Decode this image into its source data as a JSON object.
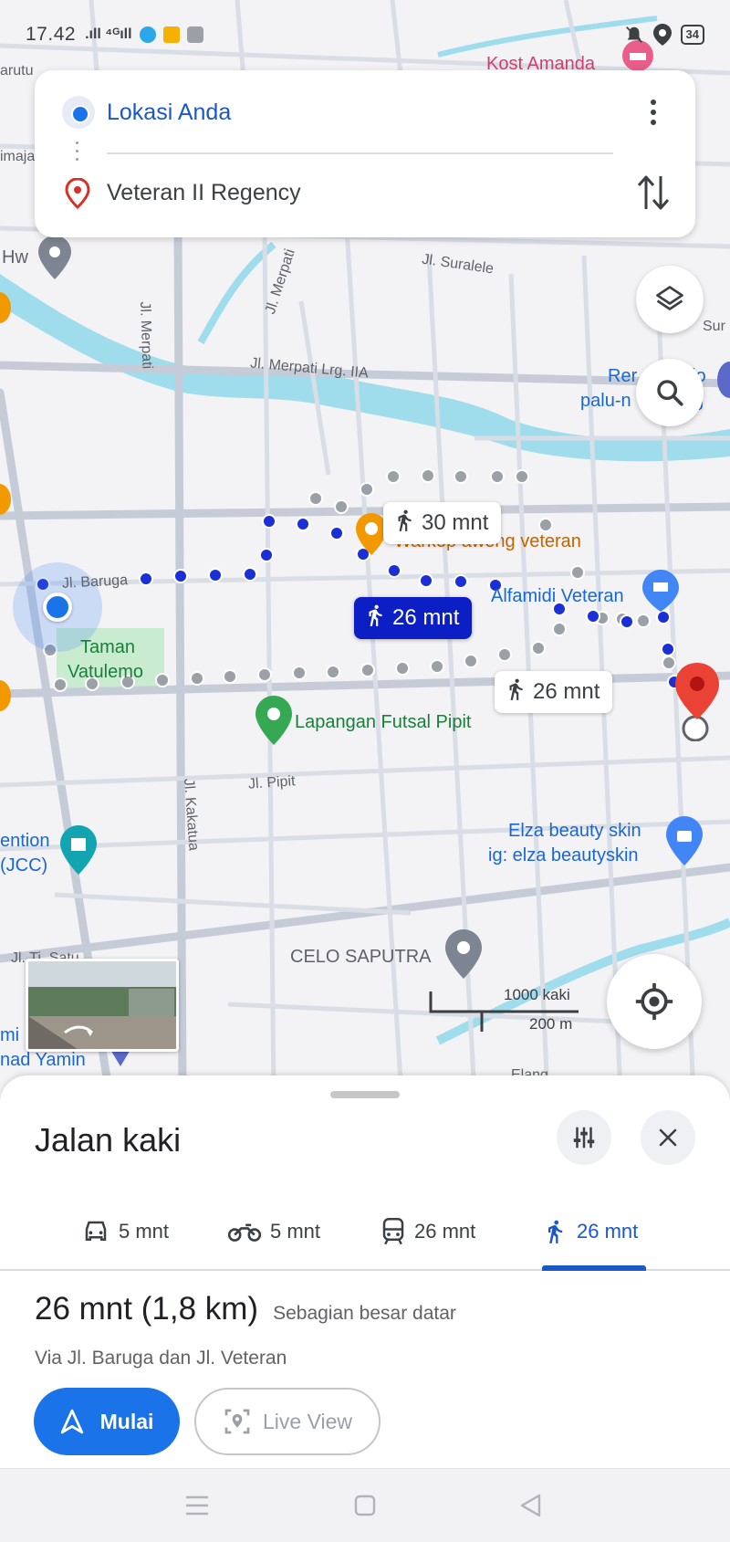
{
  "status_bar": {
    "time": "17.42",
    "signal": ".ıll ⁴ᴳıll",
    "battery": "34",
    "icons": [
      "telegram-icon",
      "gallery-icon",
      "storage-icon",
      "mute-icon",
      "location-icon",
      "battery-icon"
    ]
  },
  "search": {
    "origin": "Lokasi Anda",
    "destination": "Veteran II Regency"
  },
  "map": {
    "labels": {
      "kost": "Kost Amanda",
      "arutu": "arutu",
      "imaj": "imaja",
      "hw": "Hw",
      "merpati_v": "Jl. Merpati",
      "merpati_d": "Jl. Merpati",
      "suralele": "Jl. Suralele",
      "merpati_lrg": "Jl. Merpati Lrg. IIA",
      "sur": "Sur",
      "rer": "Rer",
      "io": "io",
      "palu": "palu-n",
      "g": "g",
      "warkop": "Warkop aweng veteran",
      "alfamidi": "Alfamidi Veteran",
      "baruga": "Jl. Baruga",
      "taman1": "Taman",
      "taman2": "Vatulemo",
      "futsal": "Lapangan Futsal Pipit",
      "pipit": "Jl. Pipit",
      "kakatua": "Jl. Kakatua",
      "ention": "ention",
      "jcc": "(JCC)",
      "elza1": "Elza beauty skin",
      "elza2": "ig: elza beautyskin",
      "tisatu": "Jl. Ti. Satu",
      "celo": "CELO SAPUTRA",
      "mi": "mi",
      "yamin": "nad Yamin",
      "elang": "Elang"
    },
    "chips": {
      "alt1": "30 mnt",
      "main": "26 mnt",
      "alt2": "26 mnt"
    },
    "scale": {
      "feet": "1000 kaki",
      "meters": "200 m"
    },
    "colors": {
      "route_main": "#1a2fd6",
      "route_alt": "#9aa0a6",
      "water": "#9fdcec",
      "park": "#c9ecd1",
      "destination": "#ea4335"
    }
  },
  "sheet": {
    "title": "Jalan kaki",
    "modes": [
      {
        "icon": "car-icon",
        "label": "5 mnt"
      },
      {
        "icon": "motorcycle-icon",
        "label": "5 mnt"
      },
      {
        "icon": "transit-icon",
        "label": "26 mnt"
      },
      {
        "icon": "walk-icon",
        "label": "26 mnt",
        "active": true
      }
    ],
    "route_time": "26 mnt (1,8 km)",
    "route_note": "Sebagian besar datar",
    "route_via": "Via Jl. Baruga dan Jl. Veteran",
    "start_label": "Mulai",
    "live_view_label": "Live View"
  }
}
